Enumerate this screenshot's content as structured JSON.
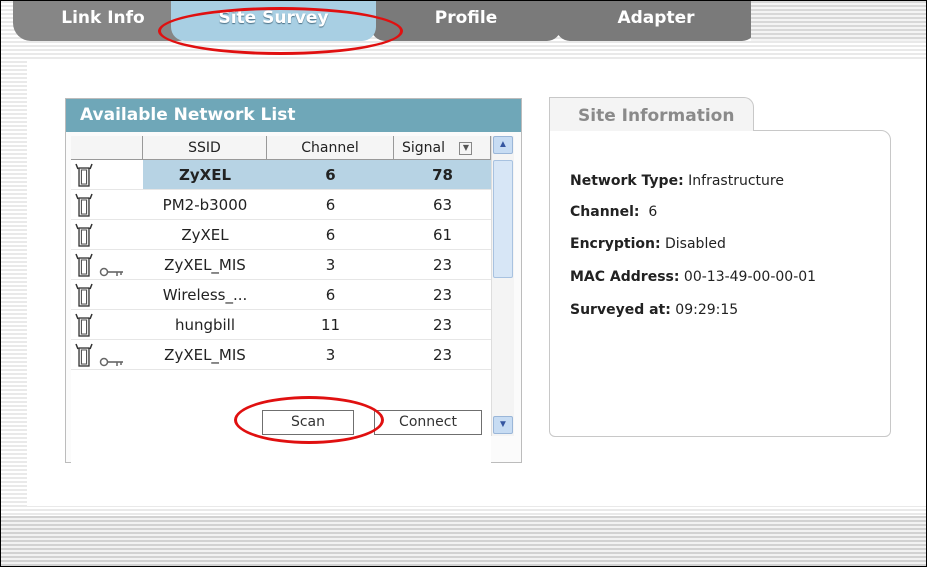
{
  "tabs": [
    {
      "label": "Link Info"
    },
    {
      "label": "Site Survey"
    },
    {
      "label": "Profile"
    },
    {
      "label": "Adapter"
    }
  ],
  "active_tab": "Site Survey",
  "network_list": {
    "title": "Available Network List",
    "columns": [
      "SSID",
      "Channel",
      "Signal"
    ],
    "rows": [
      {
        "ssid": "ZyXEL",
        "channel": "6",
        "signal": "78",
        "encrypted": false,
        "selected": true
      },
      {
        "ssid": "PM2-b3000",
        "channel": "6",
        "signal": "63",
        "encrypted": false,
        "selected": false
      },
      {
        "ssid": "ZyXEL",
        "channel": "6",
        "signal": "61",
        "encrypted": false,
        "selected": false
      },
      {
        "ssid": "ZyXEL_MIS",
        "channel": "3",
        "signal": "23",
        "encrypted": true,
        "selected": false
      },
      {
        "ssid": "Wireless_...",
        "channel": "6",
        "signal": "23",
        "encrypted": false,
        "selected": false
      },
      {
        "ssid": "hungbill",
        "channel": "11",
        "signal": "23",
        "encrypted": false,
        "selected": false
      },
      {
        "ssid": "ZyXEL_MIS",
        "channel": "3",
        "signal": "23",
        "encrypted": true,
        "selected": false
      }
    ],
    "buttons": {
      "scan": "Scan",
      "connect": "Connect"
    }
  },
  "site_info": {
    "title": "Site Information",
    "fields": [
      {
        "label": "Network Type:",
        "value": "Infrastructure"
      },
      {
        "label": "Channel:",
        "value": "6"
      },
      {
        "label": "Encryption:",
        "value": "Disabled"
      },
      {
        "label": "MAC Address:",
        "value": "00-13-49-00-00-01"
      },
      {
        "label": "Surveyed at:",
        "value": "09:29:15"
      }
    ]
  },
  "colors": {
    "tab_inactive": "#7a7a7a",
    "tab_active": "#a8cfe3",
    "list_header": "#6fa7b8",
    "row_selected": "#b7d3e4",
    "highlight_oval": "#e01010"
  }
}
